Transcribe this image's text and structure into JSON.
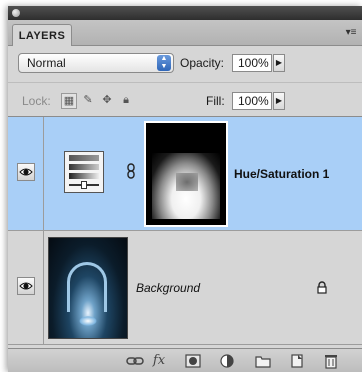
{
  "panel": {
    "tab_label": "LAYERS",
    "menu_glyph": "▾≡"
  },
  "blend": {
    "mode": "Normal",
    "opacity_label": "Opacity:",
    "opacity_value": "100%",
    "lock_label": "Lock:",
    "fill_label": "Fill:",
    "fill_value": "100%"
  },
  "layers": [
    {
      "name": "Hue/Saturation 1",
      "type": "adjustment",
      "selected": true,
      "visible": true
    },
    {
      "name": "Background",
      "type": "image",
      "selected": false,
      "visible": true,
      "locked": true
    }
  ],
  "icons": {
    "eye": "eye-icon",
    "link": "link-icon",
    "fx": "fx",
    "mask": "mask-icon",
    "adjustment": "adjustment-icon",
    "group": "folder-icon",
    "new_layer": "new-layer-icon",
    "trash": "trash-icon"
  },
  "colors": {
    "selected_row": "#a9cff7",
    "panel_bg": "#d6d6d6",
    "select_arrows": "#2f66b8"
  }
}
